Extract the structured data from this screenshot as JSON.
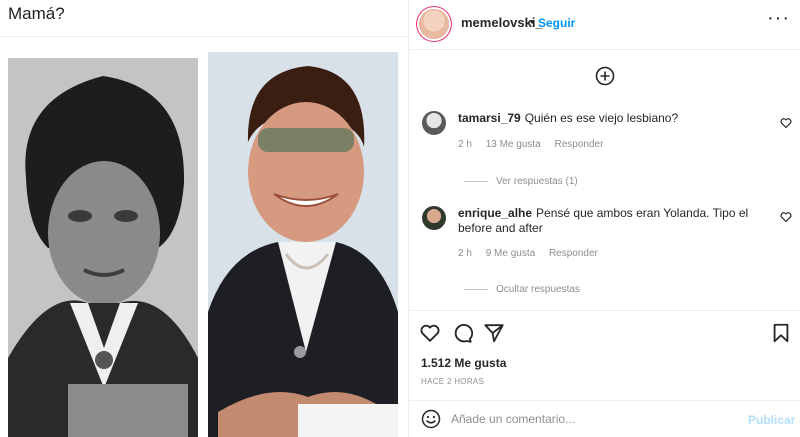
{
  "post": {
    "caption": "Mamá?",
    "header": {
      "username": "memelovski_",
      "separator": "•",
      "follow_label": "Seguir"
    },
    "comments": [
      {
        "username": "tamarsi_79",
        "text": "Quién es ese viejo lesbiano?",
        "time": "2 h",
        "likes": "13 Me gusta",
        "reply_label": "Responder",
        "thread_label": "Ver respuestas (1)"
      },
      {
        "username": "enrique_alhe",
        "text": "Pensé que ambos eran Yolanda. Tipo el before and after",
        "time": "2 h",
        "likes": "9 Me gusta",
        "reply_label": "Responder",
        "thread_label": "Ocultar respuestas"
      }
    ],
    "like_count": "1.512 Me gusta",
    "time_ago": "HACE 2 HORAS",
    "composer": {
      "placeholder": "Añade un comentario...",
      "publish_label": "Publicar"
    }
  },
  "icons": {
    "more": "more-options-icon",
    "add_comments": "plus-circle-icon",
    "like": "heart-icon",
    "comment": "comment-bubble-icon",
    "share": "paper-plane-icon",
    "save": "bookmark-icon",
    "emoji": "smiley-icon"
  },
  "colors": {
    "accent": "#0095f6",
    "publish_disabled": "#b2dffc",
    "muted_text": "#8e8e8e",
    "text": "#262626"
  }
}
